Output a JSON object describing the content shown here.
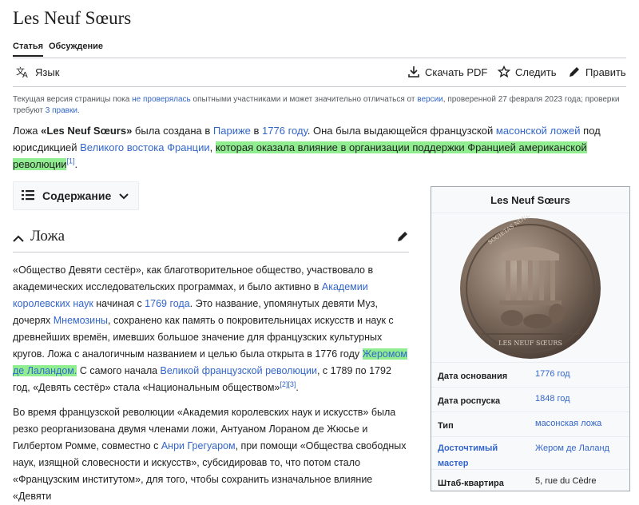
{
  "page": {
    "title": "Les Neuf Sœurs",
    "tabs": [
      "Статья",
      "Обсуждение"
    ]
  },
  "toolbar": {
    "language": "Язык",
    "download_pdf": "Скачать PDF",
    "watch": "Следить",
    "edit": "Править"
  },
  "notice": {
    "t1": "Текущая версия страницы пока ",
    "l1": "не проверялась",
    "t2": " опытными участниками и может значительно отличаться от ",
    "l2": "версии",
    "t3": ", проверенной 27 февраля 2023 года; проверки требуют ",
    "l3": "3 правки",
    "t4": "."
  },
  "lead": {
    "t1": "Ложа ",
    "bold": "«Les Neuf Sœurs»",
    "t2": " была создана в ",
    "l1": "Париже",
    "t3": " в ",
    "l2": "1776 году",
    "t4": ". Она была выдающейся французской ",
    "l3": "масонской ложей",
    "t5": " под юрисдикцией ",
    "l4": "Великого востока Франции",
    "t6": ", ",
    "hl": "которая оказала влияние в организации поддержки Францией американской революции",
    "ref": "[1]",
    "t7": "."
  },
  "toc": {
    "label": "Содержание"
  },
  "section": {
    "heading": "Ложа"
  },
  "para1": {
    "t1": "«Общество Девяти сестёр», как благотворительное общество, участвовало в академических исследовательских программах, и было активно в ",
    "l1": "Академии королевских наук",
    "t2": " начиная с ",
    "l2": "1769 года",
    "t3": ". Это название, упомянутых девяти Муз, дочерях ",
    "l3": "Мнемозины",
    "t4": ", сохранено как память о покровительницах искусств и наук с древнейших времён, имевших большое значение для французских культурных кругов. Ложа с аналогичным названием и целью была открыта в 1776 году ",
    "hl": "Жеромом де Лаландом.",
    "t5": " С самого начала ",
    "l4": "Великой французской революции",
    "t6": ", с 1789 по 1792 год, «Девять сестёр» стала «Национальным обществом»",
    "ref": "[2][3]",
    "t7": "."
  },
  "para2": {
    "t1": "Во время французской революции «Академия королевских наук и искусств» была резко реорганизована двумя членами ложи, Антуаном Лораном де Жюсье и Гилбертом Ромме, совместно с ",
    "l1": "Анри Грегуаром",
    "t2": ", при помощи «Общества свободных наук, изящной словесности и искусств», субсидировав то, что потом стало «Французским институтом», для того, чтобы сохранить изначальное влияние «Девяти"
  },
  "infobox": {
    "title": "Les Neuf Sœurs",
    "medal_text": "SOCIETAS NOVEM SORORUM",
    "medal_exergue": "LES NEUF SŒURS",
    "rows": [
      {
        "key": "Дата основания",
        "value": "1776 год"
      },
      {
        "key": "Дата роспуска",
        "value": "1848 год"
      },
      {
        "key": "Тип",
        "value": "масонская ложа"
      },
      {
        "key": "Досточтимый мастер",
        "value": "Жером де Лаланд"
      },
      {
        "key": "Штаб-квартира",
        "value": "5, rue du Cèdre"
      }
    ]
  }
}
